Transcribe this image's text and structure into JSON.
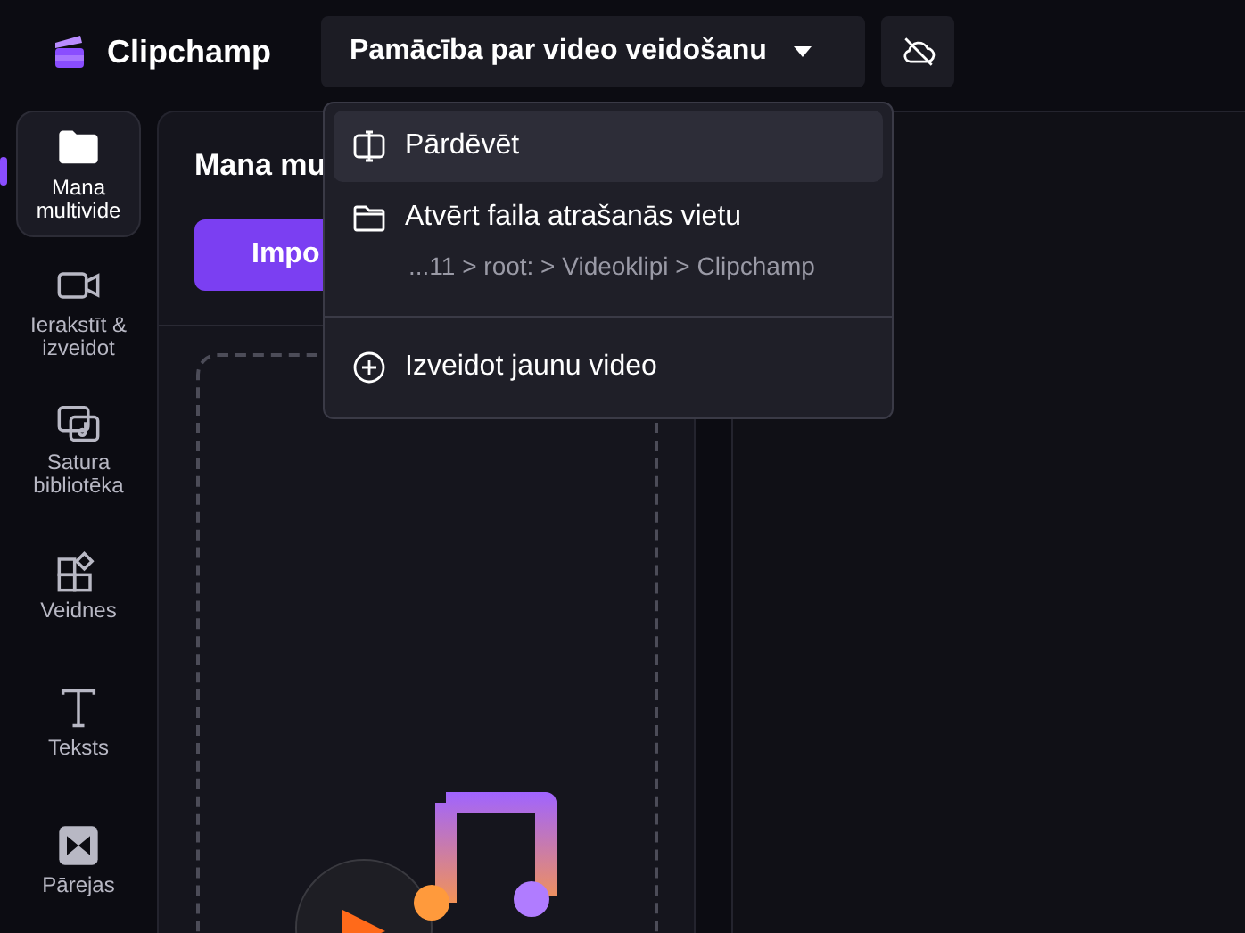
{
  "app": {
    "name": "Clipchamp"
  },
  "project_title": "Pamācība par video veidošanu",
  "sidebar": {
    "items": [
      {
        "kind": "folder",
        "label": "Mana multivide",
        "selected": true
      },
      {
        "kind": "camera",
        "label": "Ierakstīt & izveidot",
        "selected": false
      },
      {
        "kind": "library",
        "label": "Satura bibliotēka",
        "selected": false
      },
      {
        "kind": "templates",
        "label": "Veidnes",
        "selected": false
      },
      {
        "kind": "text",
        "label": "Teksts",
        "selected": false
      },
      {
        "kind": "transitions",
        "label": "Pārejas",
        "selected": false
      }
    ]
  },
  "media_panel": {
    "title": "Mana mu",
    "import_button": "Impo"
  },
  "menu": {
    "items": [
      {
        "kind": "rename",
        "label": "Pārdēvēt",
        "selected": true
      },
      {
        "kind": "open-folder",
        "label": "Atvērt faila atrašanās vietu",
        "path": "...11 > root: > Videoklipi > Clipchamp",
        "selected": false
      },
      {
        "kind": "create",
        "label": "Izveidot jaunu video",
        "selected": false
      }
    ]
  }
}
